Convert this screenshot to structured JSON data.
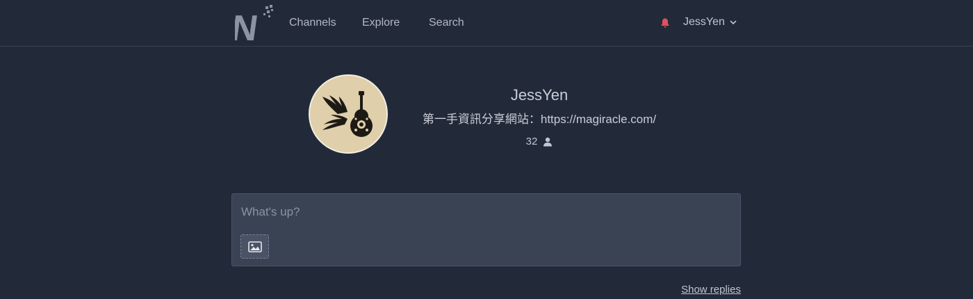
{
  "nav": {
    "logo_letter": "N",
    "links": [
      "Channels",
      "Explore",
      "Search"
    ],
    "username": "JessYen"
  },
  "profile": {
    "name": "JessYen",
    "bio": "第一手資訊分享網站：https://magiracle.com/",
    "followers": "32"
  },
  "composer": {
    "placeholder": "What's up?"
  },
  "feed": {
    "show_replies": "Show replies"
  },
  "colors": {
    "background": "#222a3a",
    "bell": "#e2515b",
    "avatar_bg": "#dfcfaa"
  }
}
